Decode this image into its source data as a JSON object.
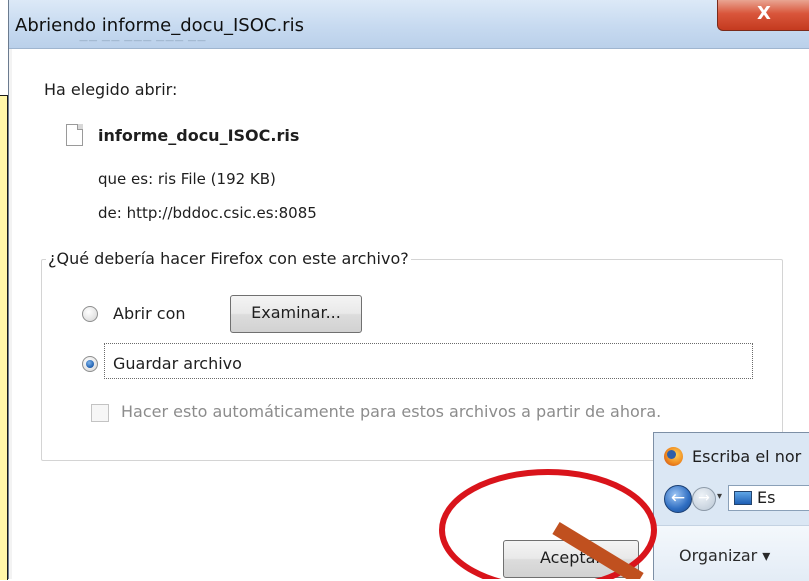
{
  "dialog": {
    "title": "Abriendo informe_docu_ISOC.ris",
    "close_label": "X",
    "ghost_menu_text": "—— —— ——— ——— ——",
    "chosen_label": "Ha elegido abrir:",
    "file_name": "informe_docu_ISOC.ris",
    "file_type": "que es:  ris File (192 KB)",
    "file_from": "de:  http://bddoc.csic.es:8085",
    "question": "¿Qué debería hacer Firefox con este archivo?",
    "option_open_label": "Abrir con",
    "browse_button": "Examinar...",
    "option_save_label": "Guardar archivo",
    "selected_option": "save",
    "auto_checkbox_label": "Hacer esto automáticamente para estos archivos a partir de ahora.",
    "auto_checkbox_checked": false,
    "accept_button": "Aceptar"
  },
  "overlay_window": {
    "title": "Escriba el nor",
    "address_text": "Es",
    "organize_label": "Organizar ▾"
  },
  "annotation": {
    "circle_color": "#d9141b",
    "arrow_color": "#c0501f",
    "strip_color": "#fff6a8"
  }
}
